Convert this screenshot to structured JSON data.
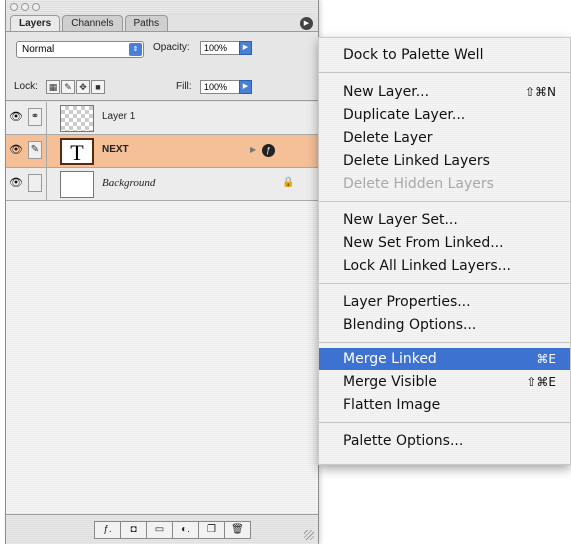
{
  "palette": {
    "tabs": [
      {
        "label": "Layers",
        "active": true
      },
      {
        "label": "Channels",
        "active": false
      },
      {
        "label": "Paths",
        "active": false
      }
    ],
    "blend_mode": "Normal",
    "opacity_label": "Opacity:",
    "opacity_value": "100%",
    "lock_label": "Lock:",
    "fill_label": "Fill:",
    "fill_value": "100%",
    "layers": [
      {
        "name": "Layer 1",
        "style": "normal",
        "thumb": "checker",
        "visible": true,
        "linked": true
      },
      {
        "name": "NEXT",
        "style": "bold",
        "thumb": "text",
        "thumb_glyph": "T",
        "selected": true,
        "visible": true
      },
      {
        "name": "Background",
        "style": "italic",
        "thumb": "white",
        "visible": true,
        "locked": true
      }
    ],
    "selected_color": "#f5bf98"
  },
  "menu": {
    "items": {
      "dock": "Dock to Palette Well",
      "new_layer": "New Layer...",
      "new_layer_sc": "⇧⌘N",
      "duplicate": "Duplicate Layer...",
      "delete": "Delete Layer",
      "delete_linked": "Delete Linked Layers",
      "delete_hidden": "Delete Hidden Layers",
      "new_set": "New Layer Set...",
      "new_set_linked": "New Set From Linked...",
      "lock_all": "Lock All Linked Layers...",
      "properties": "Layer Properties...",
      "blending": "Blending Options...",
      "merge_linked": "Merge Linked",
      "merge_linked_sc": "⌘E",
      "merge_visible": "Merge Visible",
      "merge_visible_sc": "⇧⌘E",
      "flatten": "Flatten Image",
      "palette_options": "Palette Options..."
    },
    "highlight_color": "#3d72d1",
    "disabled_item": "Delete Hidden Layers"
  }
}
